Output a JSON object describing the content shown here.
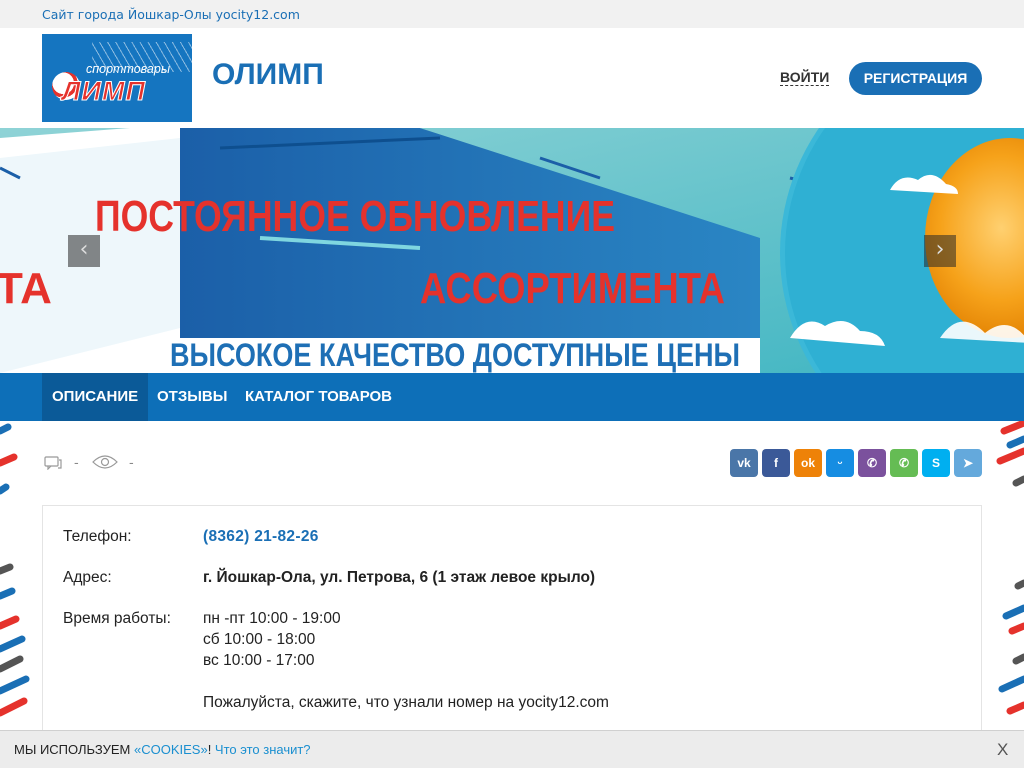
{
  "topbar": {
    "site_link": "Сайт города Йошкар-Олы yocity12.com"
  },
  "header": {
    "logo": {
      "sub": "спорттовары",
      "big": "ЛИМП"
    },
    "brand": "ОЛИМП",
    "login_label": "ВОЙТИ",
    "register_label": "РЕГИСТРАЦИЯ"
  },
  "banner": {
    "line1": "ПОСТОЯННОЕ ОБНОВЛЕНИЕ",
    "line2": "АССОРТИМЕНТА",
    "line3": "ВЫСОКОЕ КАЧЕСТВО ДОСТУПНЫЕ ЦЕНЫ",
    "edge_text": "ТА",
    "prev_icon": "chevron-left-icon",
    "next_icon": "chevron-right-icon"
  },
  "nav": {
    "tabs": [
      {
        "label": "ОПИСАНИЕ",
        "active": true
      },
      {
        "label": "ОТЗЫВЫ",
        "active": false
      },
      {
        "label": "КАТАЛОГ ТОВАРОВ",
        "active": false
      }
    ]
  },
  "stats": {
    "comments": "-",
    "views": "-"
  },
  "share": [
    {
      "name": "vk",
      "glyph": "vk",
      "color": "#4a76a8"
    },
    {
      "name": "facebook",
      "glyph": "f",
      "color": "#3b5998"
    },
    {
      "name": "odnoklassniki",
      "glyph": "ok",
      "color": "#ee8208"
    },
    {
      "name": "moimir",
      "glyph": "ᵕ",
      "color": "#168de2"
    },
    {
      "name": "viber",
      "glyph": "✆",
      "color": "#7b519d"
    },
    {
      "name": "whatsapp",
      "glyph": "✆",
      "color": "#65bc54"
    },
    {
      "name": "skype",
      "glyph": "S",
      "color": "#00aff0"
    },
    {
      "name": "telegram",
      "glyph": "➤",
      "color": "#64a9dc"
    }
  ],
  "info": {
    "phone_label": "Телефон:",
    "phone_value": "(8362) 21-82-26",
    "address_label": "Адрес:",
    "address_value": "г. Йошкар-Ола, ул. Петрова, 6 (1 этаж левое крыло)",
    "hours_label": "Время работы:",
    "hours": [
      "пн -пт 10:00 - 19:00",
      "сб 10:00 - 18:00",
      "вс 10:00 - 17:00"
    ],
    "note": "Пожалуйста, скажите, что узнали номер на yocity12.com"
  },
  "cookie": {
    "text": "МЫ ИСПОЛЬЗУЕМ ",
    "link": "«COOKIES»",
    "bang": "! ",
    "what": "Что это значит?",
    "close": "X"
  },
  "colors": {
    "accent": "#1a6fb5",
    "nav": "#0d6fb8",
    "nav_active": "#0b5a98",
    "banner_red": "#e5322c",
    "banner_blue": "#1e6fb5"
  }
}
